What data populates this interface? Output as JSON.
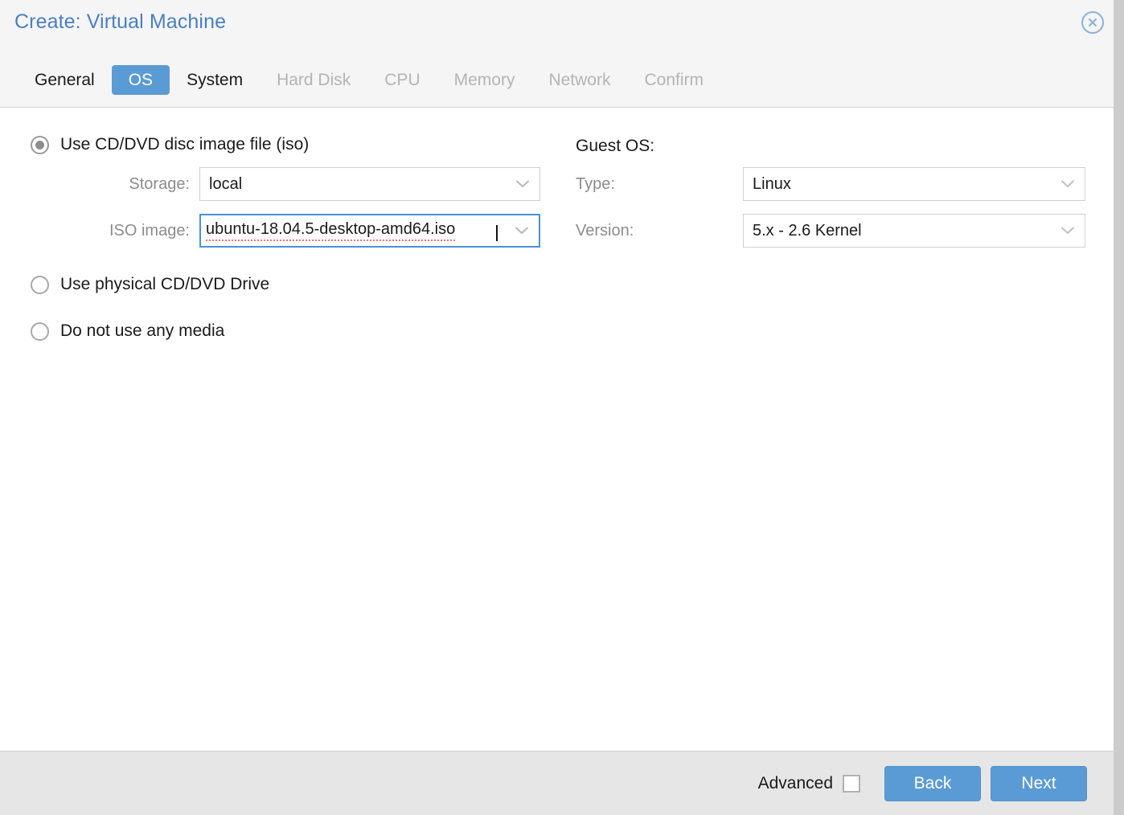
{
  "window": {
    "title": "Create: Virtual Machine",
    "close_icon": "close-circle-icon",
    "title_color": "#4a7fc0",
    "accent_color": "#5b9bd5"
  },
  "tabs": [
    {
      "label": "General",
      "state": "enabled"
    },
    {
      "label": "OS",
      "state": "active"
    },
    {
      "label": "System",
      "state": "enabled"
    },
    {
      "label": "Hard Disk",
      "state": "disabled"
    },
    {
      "label": "CPU",
      "state": "disabled"
    },
    {
      "label": "Memory",
      "state": "disabled"
    },
    {
      "label": "Network",
      "state": "disabled"
    },
    {
      "label": "Confirm",
      "state": "disabled"
    }
  ],
  "media_source": {
    "options": [
      {
        "label": "Use CD/DVD disc image file (iso)",
        "selected": true
      },
      {
        "label": "Use physical CD/DVD Drive",
        "selected": false
      },
      {
        "label": "Do not use any media",
        "selected": false
      }
    ],
    "storage": {
      "label": "Storage:",
      "value": "local",
      "arrow_icon": "chevron-down-icon"
    },
    "iso_image": {
      "label": "ISO image:",
      "value": "ubuntu-18.04.5-desktop-amd64.iso",
      "visible_value": "tu-18.04.5-desktop-amd64.iso",
      "focused": true,
      "spellcheck_underline": true,
      "caret_visible": true,
      "arrow_icon": "chevron-down-icon"
    }
  },
  "guest_os": {
    "heading": "Guest OS:",
    "type": {
      "label": "Type:",
      "value": "Linux",
      "arrow_icon": "chevron-down-icon"
    },
    "version": {
      "label": "Version:",
      "value": "5.x - 2.6 Kernel",
      "arrow_icon": "chevron-down-icon"
    }
  },
  "footer": {
    "advanced_label": "Advanced",
    "advanced_checked": false,
    "back_label": "Back",
    "next_label": "Next"
  }
}
